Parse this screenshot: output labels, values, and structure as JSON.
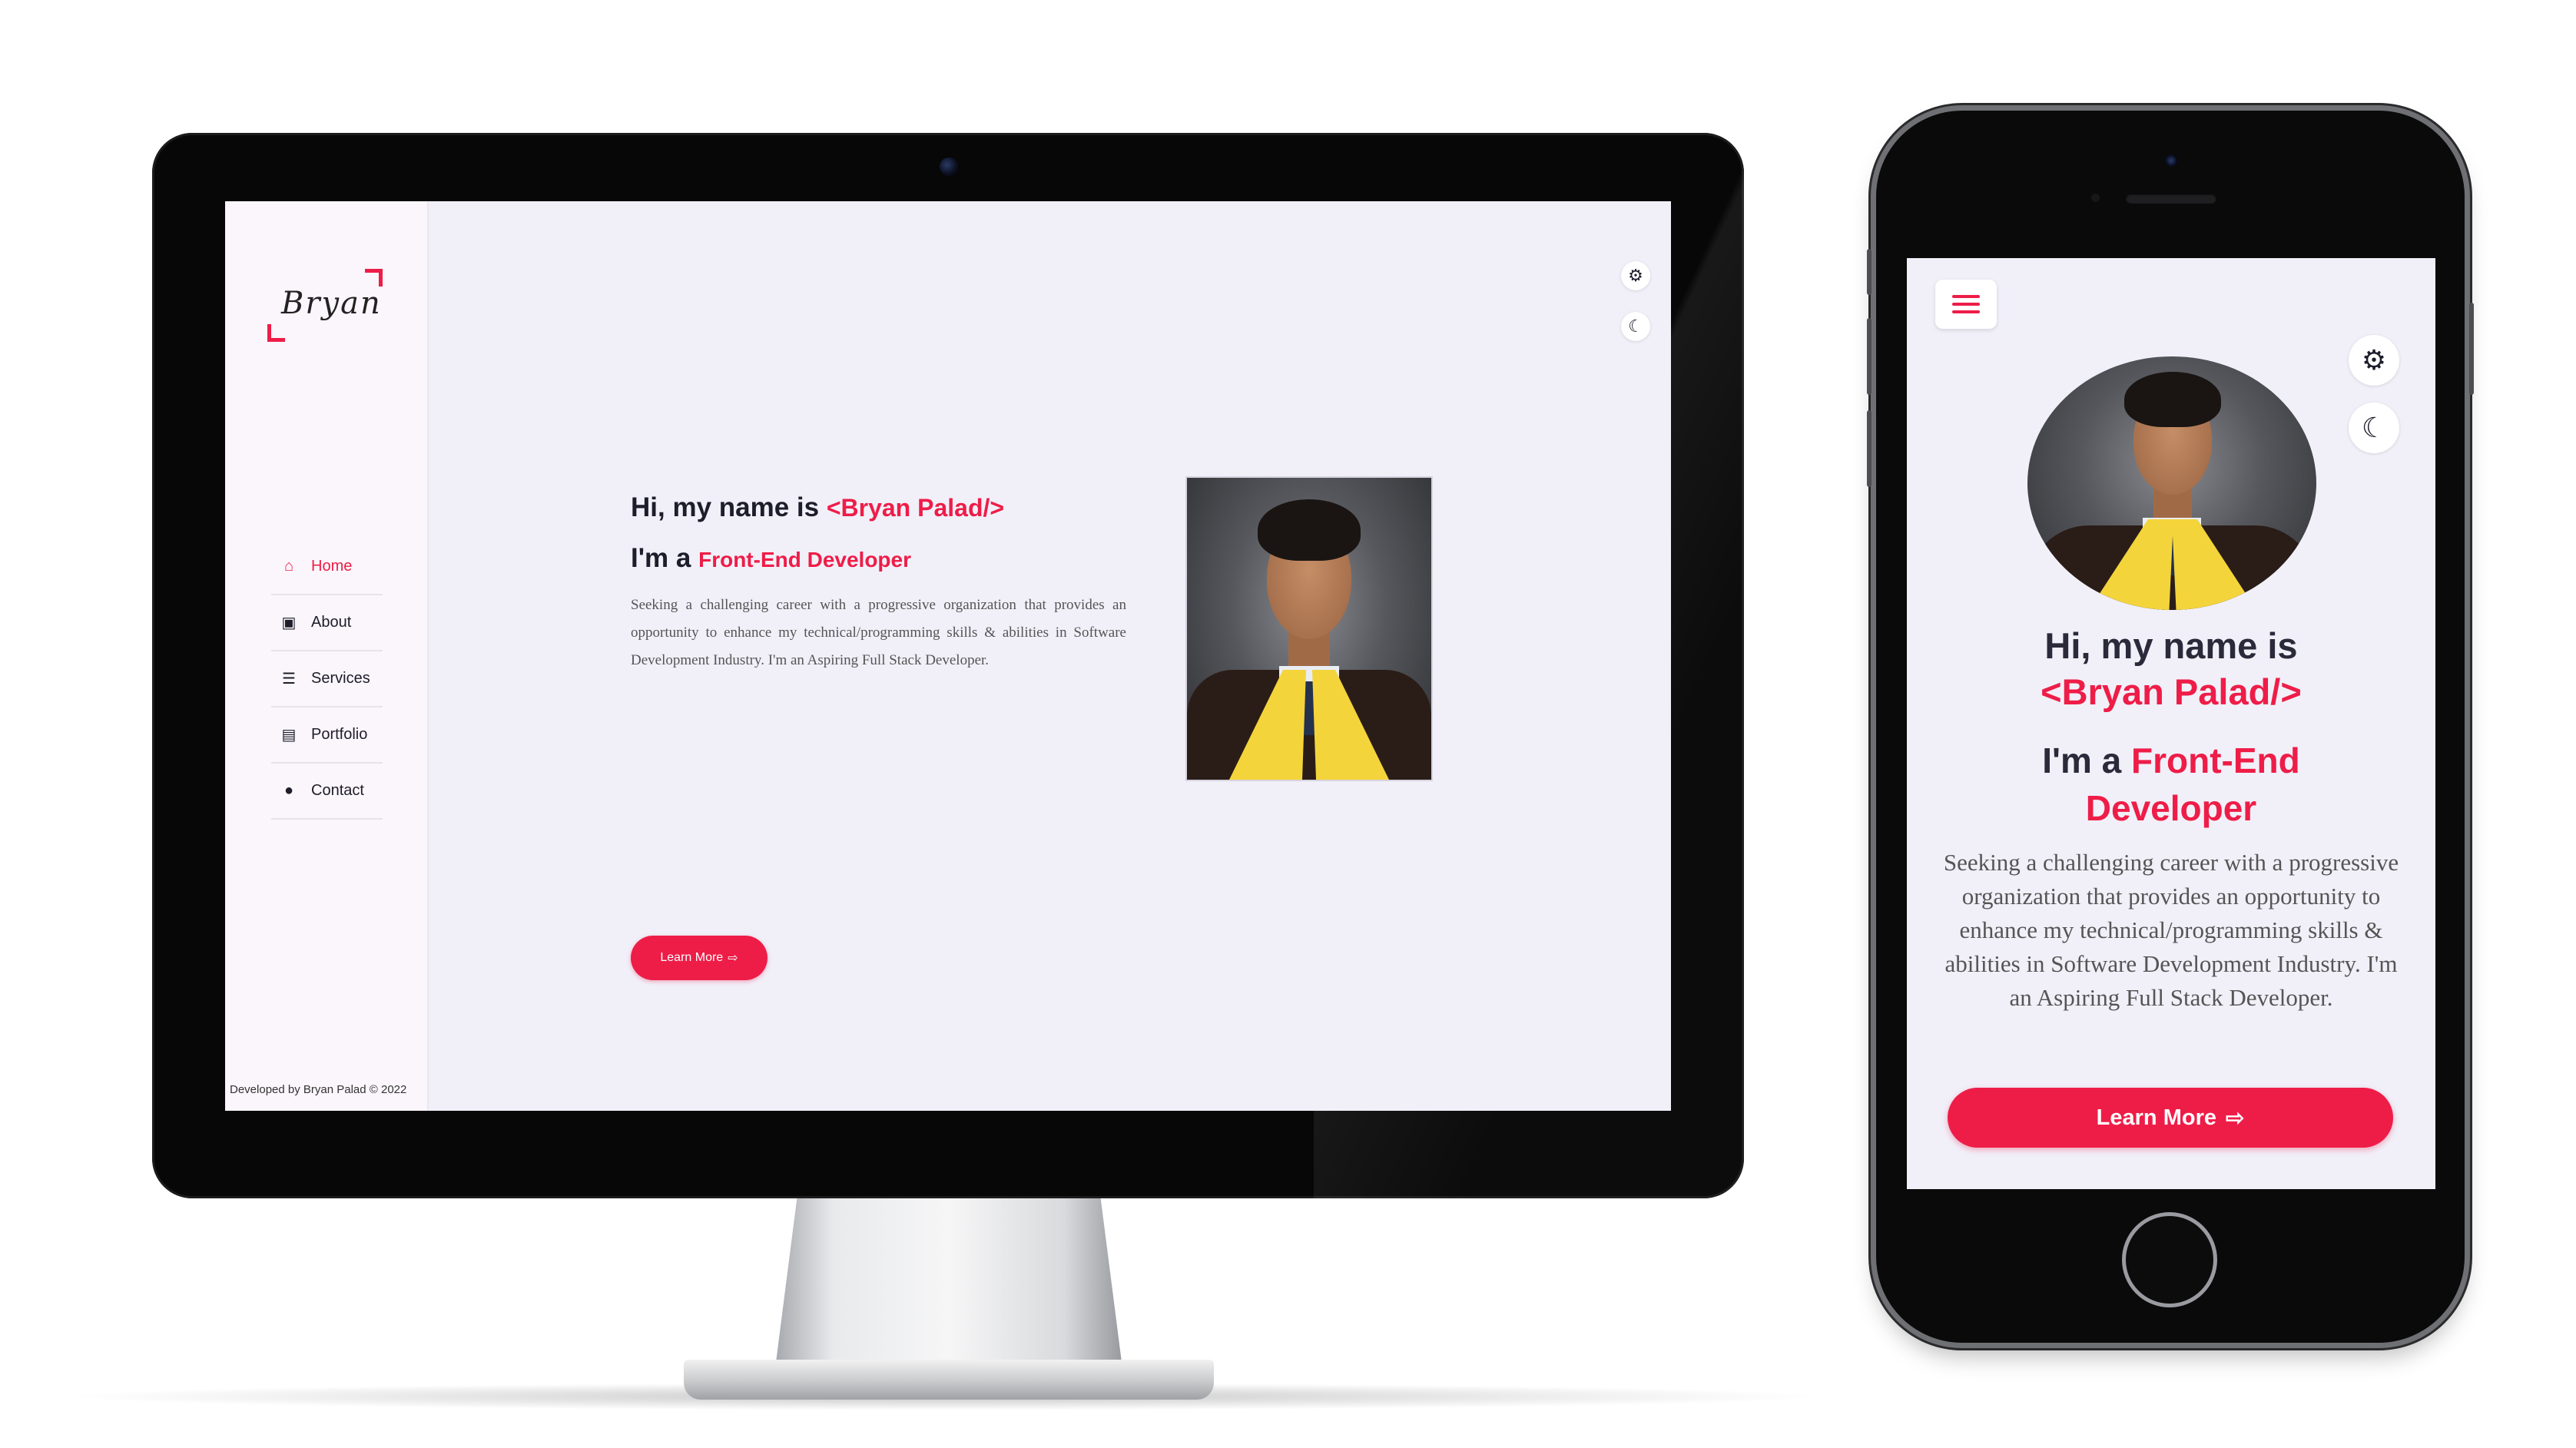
{
  "brand": {
    "logo_text": "Bryan",
    "accent_color": "#ee1d48"
  },
  "nav": {
    "items": [
      {
        "label": "Home",
        "icon": "home-icon",
        "active": true
      },
      {
        "label": "About",
        "icon": "id-card-icon",
        "active": false
      },
      {
        "label": "Services",
        "icon": "list-icon",
        "active": false
      },
      {
        "label": "Portfolio",
        "icon": "briefcase-icon",
        "active": false
      },
      {
        "label": "Contact",
        "icon": "chat-icon",
        "active": false
      }
    ]
  },
  "footer": {
    "text": "Developed by Bryan Palad © 2022"
  },
  "tools": {
    "settings_icon": "gear-icon",
    "theme_icon": "moon-icon"
  },
  "hero": {
    "greeting": "Hi, my name is ",
    "name": "<Bryan Palad/>",
    "role_prefix": "I'm a ",
    "role": "Front-End Developer",
    "description": "Seeking a challenging career with a progressive organization that provides an opportunity to enhance my technical/programming skills & abilities in Software Development Industry. I'm an Aspiring Full Stack Developer.",
    "button_label": "Learn More",
    "button_arrow": "⇨"
  },
  "mobile": {
    "menu_icon": "hamburger-icon",
    "role_word1": "Front-End",
    "role_word2": "Developer"
  }
}
